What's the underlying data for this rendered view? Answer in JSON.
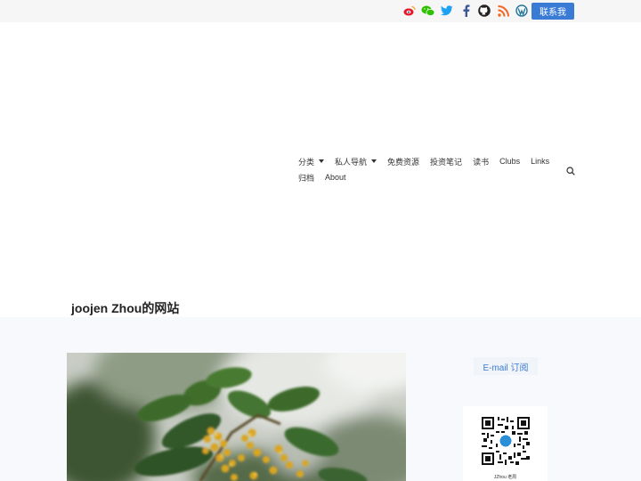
{
  "header": {
    "social_icons": [
      "weibo-icon",
      "wechat-icon",
      "twitter-icon",
      "facebook-icon",
      "github-icon",
      "rss-icon",
      "wordpress-icon"
    ],
    "contact_label": "联系我"
  },
  "nav": {
    "row1": [
      {
        "label": "分类",
        "dropdown": true
      },
      {
        "label": "私人导航",
        "dropdown": true
      },
      {
        "label": "免费资源"
      },
      {
        "label": "投资笔记"
      },
      {
        "label": "读书"
      },
      {
        "label": "Clubs"
      },
      {
        "label": "Links"
      }
    ],
    "row2": [
      {
        "label": "归档"
      },
      {
        "label": "About"
      }
    ],
    "search_icon": "search-icon"
  },
  "site": {
    "title": "joojen Zhou的网站"
  },
  "sidebar": {
    "subscribe_label": "E-mail 订阅",
    "qr_caption": "JZhou 老周"
  },
  "colors": {
    "accent": "#3a7bd5",
    "topbar": "#f6f6f6",
    "lower_bg": "#f7f9fc"
  }
}
